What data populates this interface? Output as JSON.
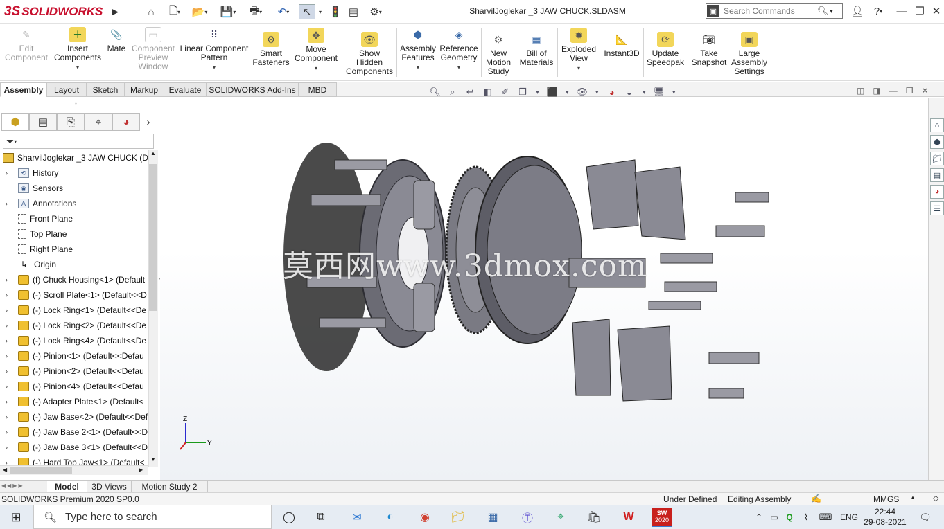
{
  "app": {
    "brand_ds": "3S",
    "brand_name": "SOLIDWORKS",
    "document_title": "SharvilJoglekar _3 JAW CHUCK.SLDASM"
  },
  "search": {
    "placeholder": "Search Commands"
  },
  "ribbon": [
    {
      "label": "Edit Component",
      "lines": [
        "Edit",
        "Component"
      ],
      "disabled": true
    },
    {
      "label": "Insert Components",
      "lines": [
        "Insert",
        "Components"
      ],
      "dropdown": true
    },
    {
      "label": "Mate",
      "lines": [
        "Mate"
      ]
    },
    {
      "label": "Component Preview Window",
      "lines": [
        "Component",
        "Preview",
        "Window"
      ],
      "disabled": true
    },
    {
      "label": "Linear Component Pattern",
      "lines": [
        "Linear Component",
        "Pattern"
      ],
      "dropdown": true
    },
    {
      "label": "Smart Fasteners",
      "lines": [
        "Smart",
        "Fasteners"
      ]
    },
    {
      "label": "Move Component",
      "lines": [
        "Move",
        "Component"
      ],
      "dropdown": true
    },
    {
      "label": "Show Hidden Components",
      "lines": [
        "Show",
        "Hidden",
        "Components"
      ]
    },
    {
      "label": "Assembly Features",
      "lines": [
        "Assembly",
        "Features"
      ],
      "dropdown": true
    },
    {
      "label": "Reference Geometry",
      "lines": [
        "Reference",
        "Geometry"
      ],
      "dropdown": true
    },
    {
      "label": "New Motion Study",
      "lines": [
        "New",
        "Motion",
        "Study"
      ]
    },
    {
      "label": "Bill of Materials",
      "lines": [
        "Bill of",
        "Materials"
      ]
    },
    {
      "label": "Exploded View",
      "lines": [
        "Exploded",
        "View"
      ],
      "dropdown": true
    },
    {
      "label": "Instant3D",
      "lines": [
        "Instant3D"
      ]
    },
    {
      "label": "Update Speedpak",
      "lines": [
        "Update",
        "Speedpak"
      ]
    },
    {
      "label": "Take Snapshot",
      "lines": [
        "Take",
        "Snapshot"
      ]
    },
    {
      "label": "Large Assembly Settings",
      "lines": [
        "Large",
        "Assembly",
        "Settings"
      ]
    }
  ],
  "command_tabs": [
    "Assembly",
    "Layout",
    "Sketch",
    "Markup",
    "Evaluate",
    "SOLIDWORKS Add-Ins",
    "MBD"
  ],
  "tree": {
    "root": "SharvilJoglekar _3 JAW CHUCK  (De",
    "items": [
      {
        "label": "History",
        "icon": "history-icon",
        "expand": true
      },
      {
        "label": "Sensors",
        "icon": "sensors-icon",
        "expand": false
      },
      {
        "label": "Annotations",
        "icon": "annotations-icon",
        "expand": true
      },
      {
        "label": "Front Plane",
        "icon": "plane-icon",
        "expand": false
      },
      {
        "label": "Top Plane",
        "icon": "plane-icon",
        "expand": false
      },
      {
        "label": "Right Plane",
        "icon": "plane-icon",
        "expand": false
      },
      {
        "label": "Origin",
        "icon": "origin-icon",
        "expand": false
      },
      {
        "label": "(f) Chuck Housing<1> (Default",
        "icon": "part-icon",
        "expand": true
      },
      {
        "label": "(-) Scroll Plate<1> (Default<<D",
        "icon": "part-icon",
        "expand": true
      },
      {
        "label": "(-) Lock Ring<1> (Default<<De",
        "icon": "part-icon",
        "expand": true
      },
      {
        "label": "(-) Lock Ring<2> (Default<<De",
        "icon": "part-icon",
        "expand": true
      },
      {
        "label": "(-) Lock Ring<4> (Default<<De",
        "icon": "part-icon",
        "expand": true
      },
      {
        "label": "(-) Pinion<1> (Default<<Defau",
        "icon": "part-icon",
        "expand": true
      },
      {
        "label": "(-) Pinion<2> (Default<<Defau",
        "icon": "part-icon",
        "expand": true
      },
      {
        "label": "(-) Pinion<4> (Default<<Defau",
        "icon": "part-icon",
        "expand": true
      },
      {
        "label": "(-) Adapter Plate<1> (Default<",
        "icon": "part-icon",
        "expand": true
      },
      {
        "label": "(-) Jaw Base<2> (Default<<Def",
        "icon": "part-icon",
        "expand": true
      },
      {
        "label": "(-) Jaw Base 2<1> (Default<<D",
        "icon": "part-icon",
        "expand": true
      },
      {
        "label": "(-) Jaw Base 3<1> (Default<<D",
        "icon": "part-icon",
        "expand": true
      },
      {
        "label": "(-) Hard Top Jaw<1> (Default<",
        "icon": "part-icon",
        "expand": true
      }
    ]
  },
  "bottom_tabs": [
    "Model",
    "3D Views",
    "Motion Study 2"
  ],
  "status": {
    "product": "SOLIDWORKS Premium 2020 SP0.0",
    "definition": "Under Defined",
    "mode": "Editing Assembly",
    "units": "MMGS"
  },
  "triad": {
    "z": "Z",
    "y": "Y"
  },
  "watermark": "莫西网www.3dmox.com",
  "taskbar": {
    "search_placeholder": "Type here to search",
    "language": "ENG",
    "time": "22:44",
    "date": "29-08-2021",
    "sw_badge": "2020"
  }
}
